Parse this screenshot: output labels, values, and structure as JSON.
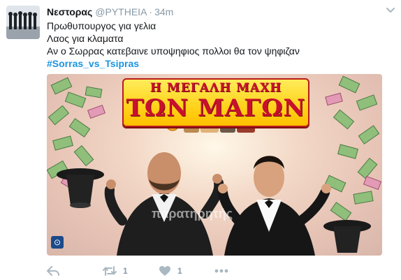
{
  "tweet": {
    "display_name": "Νεστορας",
    "handle": "@PYTHEIA",
    "separator": "·",
    "time": "34m",
    "lines": [
      "Πρωθυπουργος για γελια",
      "Λαος για κλαματα",
      "Αν ο Σωρρας κατεβαινε υποψηφιος πολλοι θα τον ψηφιζαν"
    ],
    "hashtag": "#Sorras_vs_Tsipras"
  },
  "media": {
    "banner_line1": "Η ΜΕΓΑΛΗ ΜΑΧΗ",
    "banner_line2": "ΤΩΝ ΜΑΓΩΝ",
    "watermark": "παρατηρητής"
  },
  "actions": {
    "reply_icon": "reply-icon",
    "retweet_icon": "retweet-icon",
    "retweet_count": "1",
    "like_icon": "heart-icon",
    "like_count": "1",
    "more_icon": "more-dots-icon"
  },
  "colors": {
    "hashtag": "#1b95e0",
    "muted": "#8899a6",
    "text": "#14171a",
    "banner_red": "#c8102e",
    "banner_yellow": "#ffd21a"
  }
}
